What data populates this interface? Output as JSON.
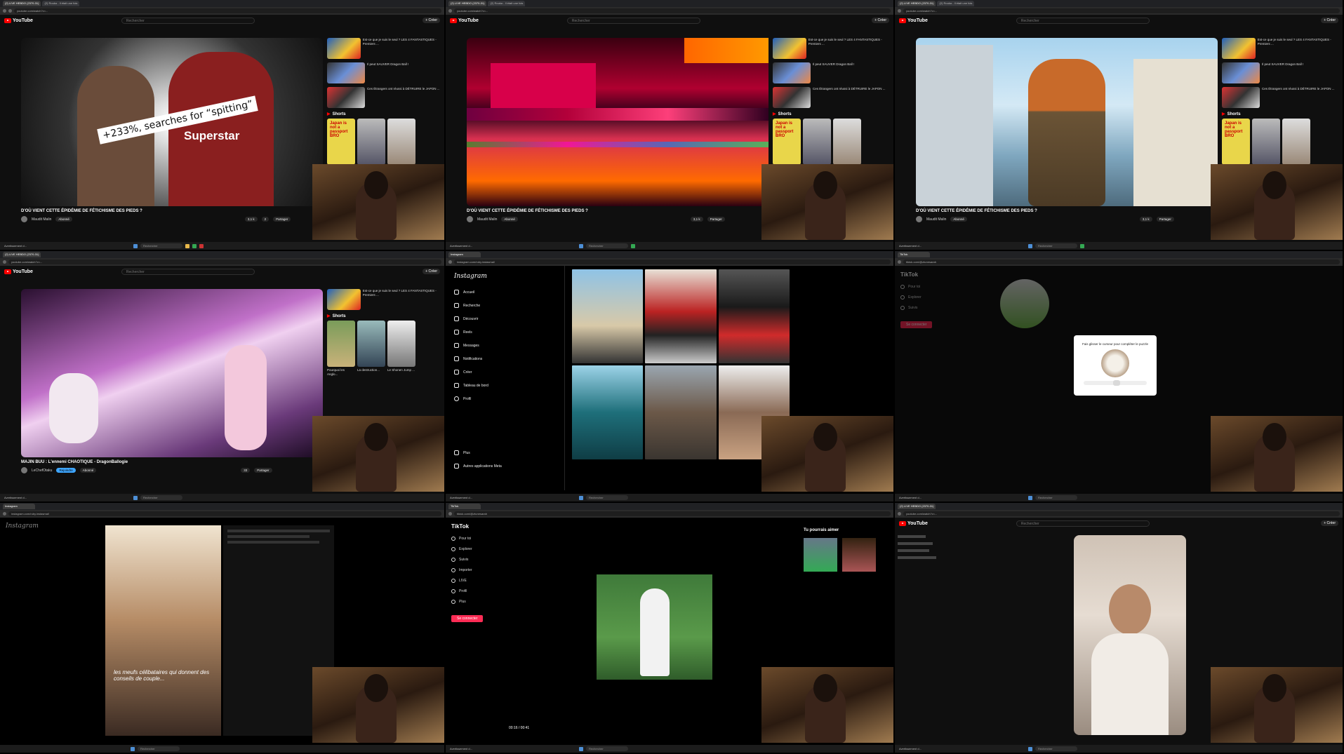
{
  "youtube": {
    "logo": "YouTube",
    "search_placeholder": "Rechercher",
    "create": "+ Créer",
    "video_title_1": "D'OÙ VIENT CETTE ÉPIDÉMIE DE FÉTICHISME DES PIEDS ?",
    "channel_1": "Maudit Malin",
    "subscribed": "Abonné",
    "share": "Partager",
    "likes_1": "3,1 k",
    "dislikes_1": "2",
    "video_title_4": "MAJIN BUU : L'ennemi CHAOTIQUE - DragonBallogie",
    "channel_4": "LeChefOtaku",
    "join": "Rejoindre",
    "likes_4": "33",
    "shorts_label": "Shorts",
    "overlay_caption": "+233%, searches for “spitting”",
    "shirt_text": "Superstar",
    "rec1": "Est-ce que je suis le seul ? LES 4 FANTASTIQUES - Premiers ...",
    "rec2": "Il peut SAUVER Dragon Ball !",
    "rec3": "Ces Étrangers ont réussi à DÉTRUIRE le JAPON ...",
    "shorts_1": "Japan is not a passport BRO",
    "short_cap_a": "Pourquoi les Anglo...",
    "short_cap_b": "La destruction...",
    "short_cap_c": "Le Shonen Jump ..."
  },
  "instagram": {
    "logo": "Instagram",
    "nav": [
      "Accueil",
      "Recherche",
      "Découvrir",
      "Reels",
      "Messages",
      "Notifications",
      "Créer",
      "Tableau de bord",
      "Profil"
    ],
    "more": "Plus",
    "meta": "Autres applications Meta",
    "reel_caption": "les meufs célibataires qui donnent des conseils de couple..."
  },
  "tiktok": {
    "logo": "TikTok",
    "nav": [
      "Pour toi",
      "Explorer",
      "Suivis",
      "Importer",
      "LIVE",
      "Profil",
      "Plus"
    ],
    "login": "Se connecter",
    "captcha_text": "Fais glisser le curseur pour compléter le puzzle",
    "suggest": "Tu pourrais aimer",
    "timer": "00:16 / 00:41"
  },
  "browser": {
    "url_yt": "youtube.com/watch?v=...",
    "url_ig": "instagram.com/ruby.instasmal/",
    "url_tt": "tiktok.com/@ztunesarah",
    "tab1": "(2) LIVE HEBDO (2370-31)",
    "tab2": "(2) Rouka - Il était une fois"
  },
  "taskbar": {
    "search": "Rechercher",
    "weather": "Avertissement d..."
  }
}
